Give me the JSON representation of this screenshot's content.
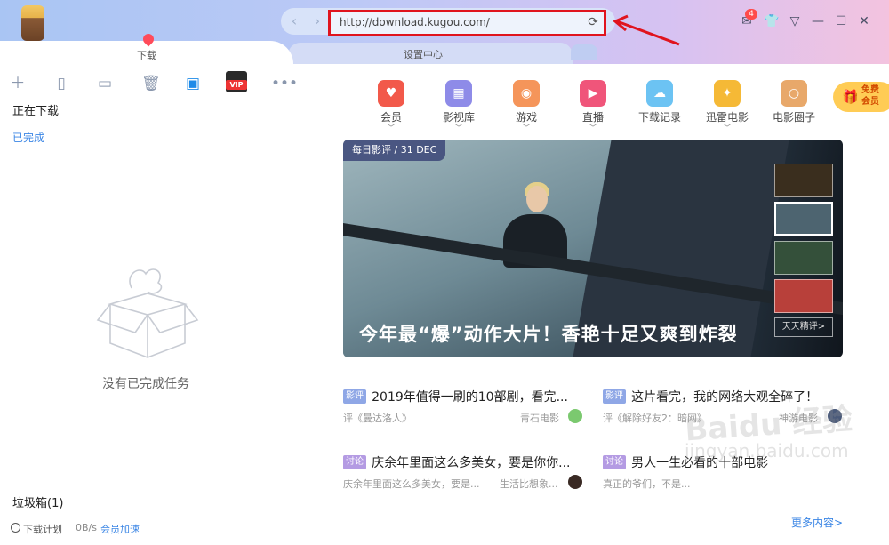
{
  "titlebar": {
    "back_icon": "chevron-left-icon",
    "forward_icon": "chevron-right-icon",
    "url": "http://download.kugou.com/",
    "refresh_icon": "refresh-icon",
    "message_badge": "4",
    "controls": [
      "message-icon",
      "skin-icon",
      "menu-icon",
      "minimize-icon",
      "maximize-icon",
      "close-icon"
    ],
    "highlight_color": "#e0141e"
  },
  "tabs": [
    {
      "label": "下载"
    },
    {
      "label": "设置中心"
    }
  ],
  "sidebar": {
    "toolbar_icons": [
      "add-icon",
      "file-icon",
      "folder-icon",
      "trash-icon",
      "video-play-icon",
      "vip-icon",
      "more-icon"
    ],
    "vip_label": "VIP",
    "downloading": "正在下载",
    "completed": "已完成",
    "empty_message": "没有已完成任务",
    "trash": "垃圾箱(1)",
    "footer": {
      "plan": "下载计划",
      "speed": "0B/s",
      "accelerate": "会员加速"
    }
  },
  "categories": [
    {
      "label": "会员",
      "icon": "heart-badge-icon",
      "color": "#f2594a",
      "glyph": "♥",
      "chevron": true
    },
    {
      "label": "影视库",
      "icon": "film-icon",
      "color": "#8e8be8",
      "glyph": "▦",
      "chevron": true
    },
    {
      "label": "游戏",
      "icon": "gamepad-icon",
      "color": "#f5955a",
      "glyph": "◉",
      "chevron": true
    },
    {
      "label": "直播",
      "icon": "tv-icon",
      "color": "#f0557a",
      "glyph": "▶",
      "chevron": true
    },
    {
      "label": "下载记录",
      "icon": "cloud-icon",
      "color": "#6cc3f3",
      "glyph": "☁",
      "chevron": false
    },
    {
      "label": "迅雷电影",
      "icon": "bird-icon",
      "color": "#f5b936",
      "glyph": "✦",
      "chevron": true
    },
    {
      "label": "电影圈子",
      "icon": "ring-icon",
      "color": "#e8a86a",
      "glyph": "○",
      "chevron": false
    }
  ],
  "free_member": {
    "line1": "免费",
    "line2": "会员"
  },
  "banner": {
    "tag": "每日影评 / 31 DEC",
    "title": "今年最“爆”动作大片！香艳十足又爽到炸裂",
    "more": "天天精评>"
  },
  "articles": [
    {
      "tag": "影评",
      "tag_type": "review",
      "title": "2019年值得一刷的10部剧，看完...",
      "sub": "评《曼达洛人》",
      "source": "青石电影"
    },
    {
      "tag": "影评",
      "tag_type": "review",
      "title": "这片看完，我的网络大观全碎了！",
      "sub": "评《解除好友2：暗网》",
      "source": "神游电影"
    },
    {
      "tag": "讨论",
      "tag_type": "discuss",
      "title": "庆余年里面这么多美女，要是你你...",
      "sub": "庆余年里面这么多美女，要是...",
      "source": "生活比想象..."
    },
    {
      "tag": "讨论",
      "tag_type": "discuss",
      "title": "男人一生必看的十部电影",
      "sub": "真正的爷们，不是...",
      "source": ""
    }
  ],
  "more_content": "更多内容>",
  "watermark": {
    "brand": "Baidu 经验",
    "url": "jingyan.baidu.com"
  }
}
